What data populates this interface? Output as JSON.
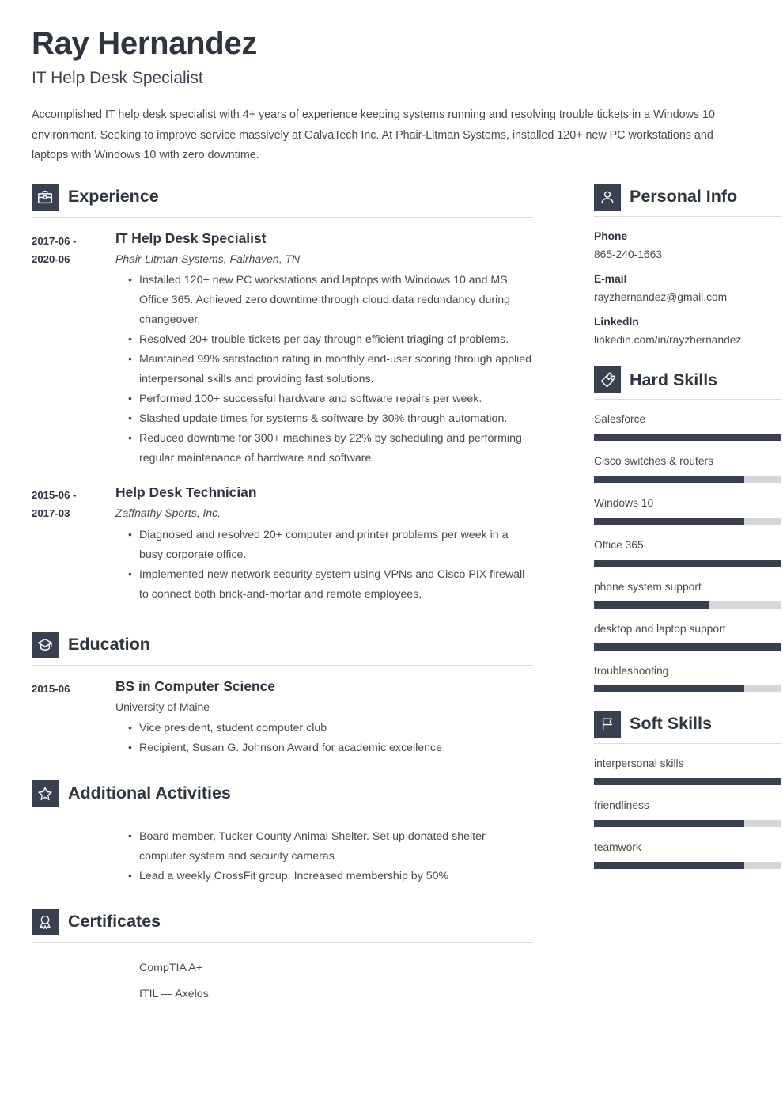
{
  "header": {
    "name": "Ray Hernandez",
    "job_title": "IT Help Desk Specialist",
    "summary": "Accomplished IT help desk specialist with 4+ years of experience keeping systems running and resolving trouble tickets in a Windows 10 environment. Seeking to improve service massively at GalvaTech Inc. At Phair-Litman Systems, installed 120+ new PC workstations and laptops with Windows 10 with zero downtime."
  },
  "sections": {
    "experience": {
      "title": "Experience",
      "icon": "briefcase-icon",
      "entries": [
        {
          "date": "2017-06 -\n2020-06",
          "date_line1": "2017-06 -",
          "date_line2": "2020-06",
          "title": "IT Help Desk Specialist",
          "subtitle": "Phair-Litman Systems, Fairhaven, TN",
          "bullets": [
            "Installed 120+ new PC workstations and laptops with Windows 10 and MS Office 365. Achieved zero downtime through cloud data redundancy during changeover.",
            "Resolved 20+ trouble tickets per day through efficient triaging of problems.",
            "Maintained 99% satisfaction rating in monthly end-user scoring through applied interpersonal skills and providing fast solutions.",
            "Performed 100+ successful hardware and software repairs per week.",
            "Slashed update times for systems & software by 30% through automation.",
            "Reduced downtime for 300+ machines by 22% by scheduling and performing regular maintenance of hardware and software."
          ]
        },
        {
          "date_line1": "2015-06 -",
          "date_line2": "2017-03",
          "title": "Help Desk Technician",
          "subtitle": "Zaffnathy Sports, Inc.",
          "bullets": [
            "Diagnosed and resolved 20+ computer and printer problems per week in a busy corporate office.",
            "Implemented new network security system using VPNs and Cisco PIX firewall to connect both brick-and-mortar and remote employees."
          ]
        }
      ]
    },
    "education": {
      "title": "Education",
      "icon": "graduation-cap-icon",
      "entries": [
        {
          "date_line1": "2015-06",
          "date_line2": "",
          "title": "BS in Computer Science",
          "subtitle": "University of Maine",
          "bullets": [
            "Vice president, student computer club",
            "Recipient, Susan G. Johnson Award for academic excellence"
          ]
        }
      ]
    },
    "additional_activities": {
      "title": "Additional Activities",
      "icon": "star-icon",
      "bullets": [
        "Board member, Tucker County Animal Shelter. Set up donated shelter computer system and security cameras",
        "Lead a weekly CrossFit group. Increased membership by 50%"
      ]
    },
    "certificates": {
      "title": "Certificates",
      "icon": "award-ribbon-icon",
      "items": [
        "CompTIA A+",
        "ITIL — Axelos"
      ]
    },
    "personal_info": {
      "title": "Personal Info",
      "icon": "person-icon",
      "fields": [
        {
          "label": "Phone",
          "value": "865-240-1663"
        },
        {
          "label": "E-mail",
          "value": "rayzhernandez@gmail.com"
        },
        {
          "label": "LinkedIn",
          "value": "linkedin.com/in/rayzhernandez"
        }
      ]
    },
    "hard_skills": {
      "title": "Hard Skills",
      "icon": "puzzle-piece-icon",
      "skills": [
        {
          "name": "Salesforce",
          "level": 100
        },
        {
          "name": "Cisco switches & routers",
          "level": 80
        },
        {
          "name": "Windows 10",
          "level": 80
        },
        {
          "name": "Office 365",
          "level": 100
        },
        {
          "name": "phone system support",
          "level": 61
        },
        {
          "name": "desktop and laptop support",
          "level": 100
        },
        {
          "name": "troubleshooting",
          "level": 80
        }
      ]
    },
    "soft_skills": {
      "title": "Soft Skills",
      "icon": "flag-icon",
      "skills": [
        {
          "name": "interpersonal skills",
          "level": 100
        },
        {
          "name": "friendliness",
          "level": 80
        },
        {
          "name": "teamwork",
          "level": 80
        }
      ]
    }
  },
  "theme": {
    "accent": "#39404f",
    "text": "#4a4a4a",
    "heading": "#2e3440",
    "rule": "#dcdcdc",
    "bar_track": "#d4d6d7"
  }
}
